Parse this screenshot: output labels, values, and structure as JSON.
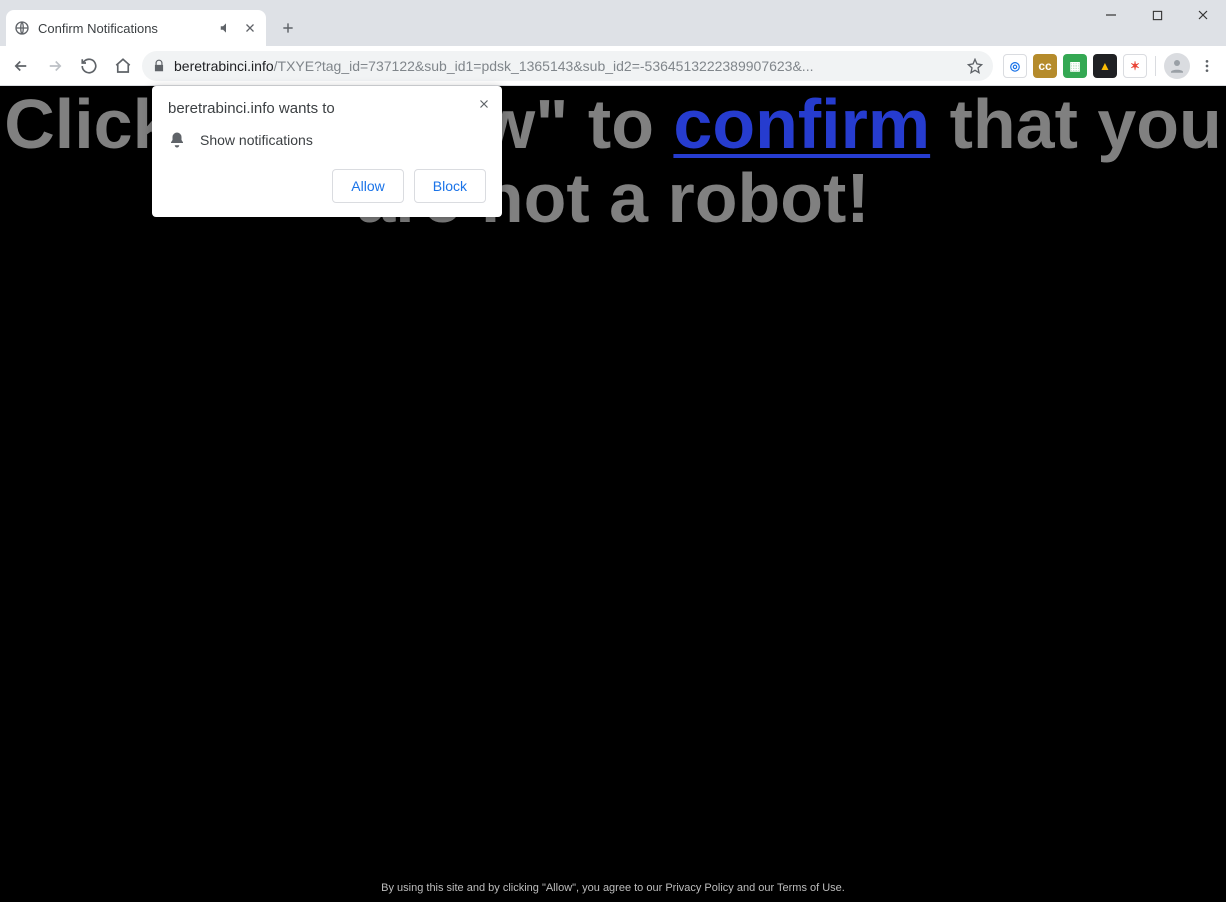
{
  "window": {
    "tab_title": "Confirm Notifications"
  },
  "omnibox": {
    "host": "beretrabinci.info",
    "path": "/TXYE?tag_id=737122&sub_id1=pdsk_1365143&sub_id2=-5364513222389907623&..."
  },
  "extensions": [
    {
      "name": "ext-spiral",
      "bg": "#ffffff",
      "fg": "#1a73e8",
      "glyph": "◎"
    },
    {
      "name": "ext-cc",
      "bg": "#b58b2b",
      "fg": "#ffffff",
      "glyph": "cc"
    },
    {
      "name": "ext-doc",
      "bg": "#34a853",
      "fg": "#ffffff",
      "glyph": "▦"
    },
    {
      "name": "ext-a",
      "bg": "#202124",
      "fg": "#fbbc04",
      "glyph": "▲"
    },
    {
      "name": "ext-paint",
      "bg": "#ffffff",
      "fg": "#ea4335",
      "glyph": "✶"
    }
  ],
  "page": {
    "headline_part1": "Click the \"Allow\" to ",
    "headline_link": "confirm",
    "headline_part2": " that you are not a robot!",
    "footer": "By using this site and by clicking \"Allow\", you agree to our Privacy Policy and our Terms of Use."
  },
  "permission": {
    "origin_wants_to": "beretrabinci.info wants to",
    "request_text": "Show notifications",
    "allow_label": "Allow",
    "block_label": "Block"
  }
}
